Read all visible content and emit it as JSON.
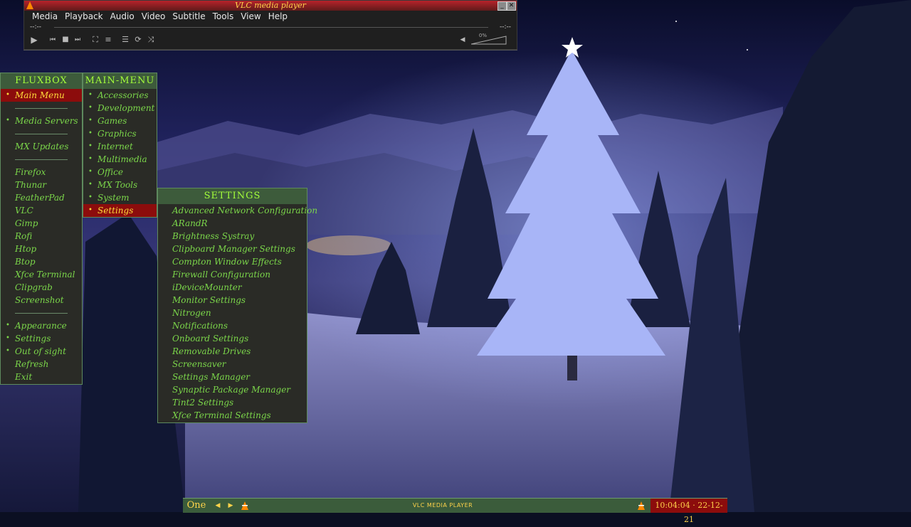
{
  "vlc": {
    "title": "VLC media player",
    "menus": [
      "Media",
      "Playback",
      "Audio",
      "Video",
      "Subtitle",
      "Tools",
      "View",
      "Help"
    ],
    "time_elapsed": "--:--",
    "time_total": "--:--",
    "volume": "0%"
  },
  "fluxbox_menu": {
    "title": "FLUXBOX",
    "items": [
      {
        "label": "Main Menu",
        "submenu": true,
        "selected": true
      },
      {
        "separator": true
      },
      {
        "label": "Media Servers",
        "submenu": true
      },
      {
        "separator": true
      },
      {
        "label": "MX Updates"
      },
      {
        "separator": true
      },
      {
        "label": "Firefox"
      },
      {
        "label": "Thunar"
      },
      {
        "label": "FeatherPad"
      },
      {
        "label": "VLC"
      },
      {
        "label": "Gimp"
      },
      {
        "label": "Rofi"
      },
      {
        "label": "Htop"
      },
      {
        "label": "Btop"
      },
      {
        "label": "Xfce Terminal"
      },
      {
        "label": "Clipgrab"
      },
      {
        "label": "Screenshot"
      },
      {
        "separator": true
      },
      {
        "label": "Appearance",
        "submenu": true
      },
      {
        "label": "Settings",
        "submenu": true
      },
      {
        "label": "Out of sight",
        "submenu": true
      },
      {
        "label": "Refresh"
      },
      {
        "label": "Exit"
      }
    ]
  },
  "main_menu": {
    "title": "MAIN-MENU",
    "items": [
      {
        "label": "Accessories",
        "submenu": true
      },
      {
        "label": "Development",
        "submenu": true
      },
      {
        "label": "Games",
        "submenu": true
      },
      {
        "label": "Graphics",
        "submenu": true
      },
      {
        "label": "Internet",
        "submenu": true
      },
      {
        "label": "Multimedia",
        "submenu": true
      },
      {
        "label": "Office",
        "submenu": true
      },
      {
        "label": "MX Tools",
        "submenu": true
      },
      {
        "label": "System",
        "submenu": true
      },
      {
        "label": "Settings",
        "submenu": true,
        "selected": true
      }
    ]
  },
  "settings_menu": {
    "title": "SETTINGS",
    "items": [
      {
        "label": "Advanced Network Configuration"
      },
      {
        "label": "ARandR"
      },
      {
        "label": "Brightness Systray"
      },
      {
        "label": "Clipboard Manager Settings"
      },
      {
        "label": "Compton Window Effects"
      },
      {
        "label": "Firewall Configuration"
      },
      {
        "label": "iDeviceMounter"
      },
      {
        "label": "Monitor Settings"
      },
      {
        "label": "Nitrogen"
      },
      {
        "label": "Notifications"
      },
      {
        "label": "Onboard Settings"
      },
      {
        "label": "Removable Drives"
      },
      {
        "label": "Screensaver"
      },
      {
        "label": "Settings Manager"
      },
      {
        "label": "Synaptic Package Manager"
      },
      {
        "label": "Tint2 Settings"
      },
      {
        "label": "Xfce Terminal Settings"
      }
    ]
  },
  "taskbar": {
    "workspace": "One",
    "task_title": "VLC MEDIA PLAYER",
    "clock": "10:04:04 · 22-12-21"
  },
  "colors": {
    "menu_bg": "#2a2b26",
    "menu_title_bg": "#3d5b3b",
    "menu_text": "#7bd64a",
    "selected_bg": "#8c0c0c",
    "selected_text": "#ffdb3a",
    "title_text": "#a4ff3a"
  }
}
